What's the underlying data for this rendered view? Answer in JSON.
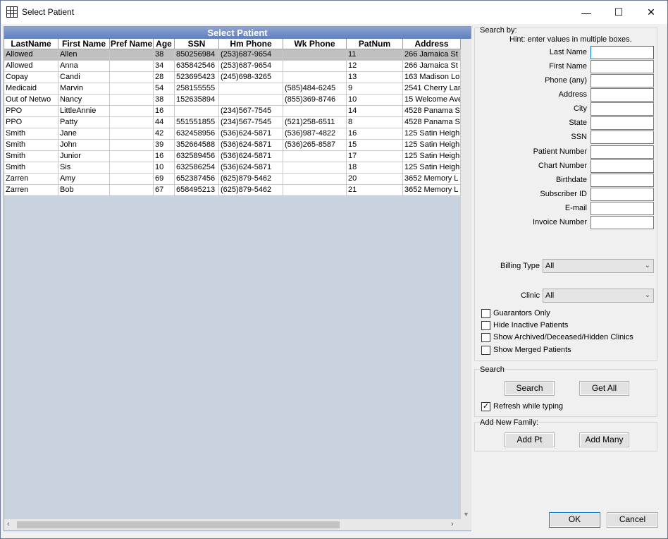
{
  "window": {
    "title": "Select Patient",
    "icon": "grid-icon",
    "controls": {
      "minimize": "—",
      "maximize": "☐",
      "close": "✕"
    }
  },
  "grid": {
    "title": "Select Patient",
    "columns": [
      "LastName",
      "First Name",
      "Pref Name",
      "Age",
      "SSN",
      "Hm Phone",
      "Wk Phone",
      "PatNum",
      "Address"
    ],
    "rows": [
      [
        "Allowed",
        "Allen",
        "",
        "38",
        "850256984",
        "(253)687-9654",
        "",
        "11",
        "266  Jamaica St"
      ],
      [
        "Allowed",
        "Anna",
        "",
        "34",
        "635842546",
        "(253)687-9654",
        "",
        "12",
        "266  Jamaica St"
      ],
      [
        "Copay",
        "Candi",
        "",
        "28",
        "523695423",
        "(245)698-3265",
        "",
        "13",
        "163 Madison Lo"
      ],
      [
        "Medicaid",
        "Marvin",
        "",
        "54",
        "258155555",
        "",
        "(585)484-6245",
        "9",
        "2541 Cherry Lan"
      ],
      [
        "Out of Netwo",
        "Nancy",
        "",
        "38",
        "152635894",
        "",
        "(855)369-8746",
        "10",
        "15 Welcome Ave"
      ],
      [
        "PPO",
        "LittleAnnie",
        "",
        "16",
        "",
        "(234)567-7545",
        "",
        "14",
        "4528 Panama St"
      ],
      [
        "PPO",
        "Patty",
        "",
        "44",
        "551551855",
        "(234)567-7545",
        "(521)258-6511",
        "8",
        "4528 Panama St"
      ],
      [
        "Smith",
        "Jane",
        "",
        "42",
        "632458956",
        "(536)624-5871",
        "(536)987-4822",
        "16",
        "125 Satin Heigh"
      ],
      [
        "Smith",
        "John",
        "",
        "39",
        "352664588",
        "(536)624-5871",
        "(536)265-8587",
        "15",
        "125 Satin Heigh"
      ],
      [
        "Smith",
        "Junior",
        "",
        "16",
        "632589456",
        "(536)624-5871",
        "",
        "17",
        "125 Satin Heigh"
      ],
      [
        "Smith",
        "Sis",
        "",
        "10",
        "632586254",
        "(536)624-5871",
        "",
        "18",
        "125 Satin Heigh"
      ],
      [
        "Zarren",
        "Amy",
        "",
        "69",
        "652387456",
        "(625)879-5462",
        "",
        "20",
        "3652  Memory L"
      ],
      [
        "Zarren",
        "Bob",
        "",
        "67",
        "658495213",
        "(625)879-5462",
        "",
        "21",
        "3652  Memory L"
      ]
    ],
    "selected_row": 0
  },
  "search": {
    "section_label": "Search by:",
    "hint": "Hint: enter values in multiple boxes.",
    "fields": [
      {
        "label": "Last Name",
        "value": ""
      },
      {
        "label": "First Name",
        "value": ""
      },
      {
        "label": "Phone (any)",
        "value": ""
      },
      {
        "label": "Address",
        "value": ""
      },
      {
        "label": "City",
        "value": ""
      },
      {
        "label": "State",
        "value": ""
      },
      {
        "label": "SSN",
        "value": ""
      },
      {
        "label": "Patient Number",
        "value": ""
      },
      {
        "label": "Chart Number",
        "value": ""
      },
      {
        "label": "Birthdate",
        "value": ""
      },
      {
        "label": "Subscriber ID",
        "value": ""
      },
      {
        "label": "E-mail",
        "value": ""
      },
      {
        "label": "Invoice Number",
        "value": ""
      }
    ],
    "billing_type_label": "Billing Type",
    "billing_type_value": "All",
    "clinic_label": "Clinic",
    "clinic_value": "All",
    "checkboxes": [
      {
        "label": "Guarantors Only",
        "checked": false
      },
      {
        "label": "Hide Inactive Patients",
        "checked": false
      },
      {
        "label": "Show Archived/Deceased/Hidden Clinics",
        "checked": false
      },
      {
        "label": "Show Merged Patients",
        "checked": false
      }
    ]
  },
  "search_actions": {
    "label": "Search",
    "search_button": "Search",
    "get_all_button": "Get All",
    "refresh_label": "Refresh while typing",
    "refresh_checked": true
  },
  "add_family": {
    "label": "Add New Family:",
    "add_pt_button": "Add Pt",
    "add_many_button": "Add Many"
  },
  "footer": {
    "ok_button": "OK",
    "cancel_button": "Cancel"
  }
}
